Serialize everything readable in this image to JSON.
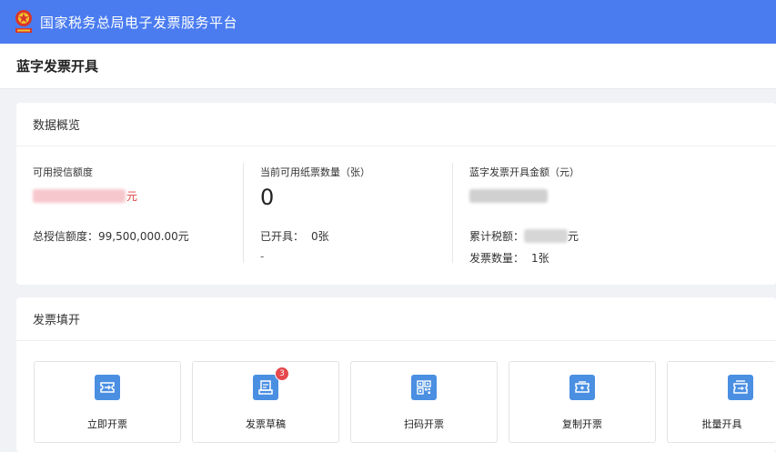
{
  "header": {
    "platform_title": "国家税务总局电子发票服务平台",
    "bg_color": "#4a7cf0"
  },
  "page": {
    "title": "蓝字发票开具"
  },
  "overview": {
    "title": "数据概览",
    "credit": {
      "label": "可用授信额度",
      "unit": "元",
      "total_label": "总授信额度：",
      "total_value": "99,500,000.00元"
    },
    "paper": {
      "label": "当前可用纸票数量（张）",
      "value": "0",
      "issued_label": "已开具：",
      "issued_value": "0张",
      "extra": "-"
    },
    "amount": {
      "label": "蓝字发票开具金额（元）",
      "tax_label": "累计税额：",
      "tax_unit": "元",
      "count_label": "发票数量：",
      "count_value": "1张"
    }
  },
  "fill": {
    "title": "发票填开",
    "accent_color": "#4a8fe2",
    "badge_color": "#e5484d",
    "tiles": [
      {
        "label": "立即开票",
        "icon": "invoice-ticket-icon"
      },
      {
        "label": "发票草稿",
        "icon": "draft-document-icon",
        "badge": "3"
      },
      {
        "label": "扫码开票",
        "icon": "qr-code-icon"
      },
      {
        "label": "复制开票",
        "icon": "copy-ticket-icon"
      },
      {
        "label": "批量开具",
        "icon": "batch-ticket-icon"
      }
    ]
  }
}
